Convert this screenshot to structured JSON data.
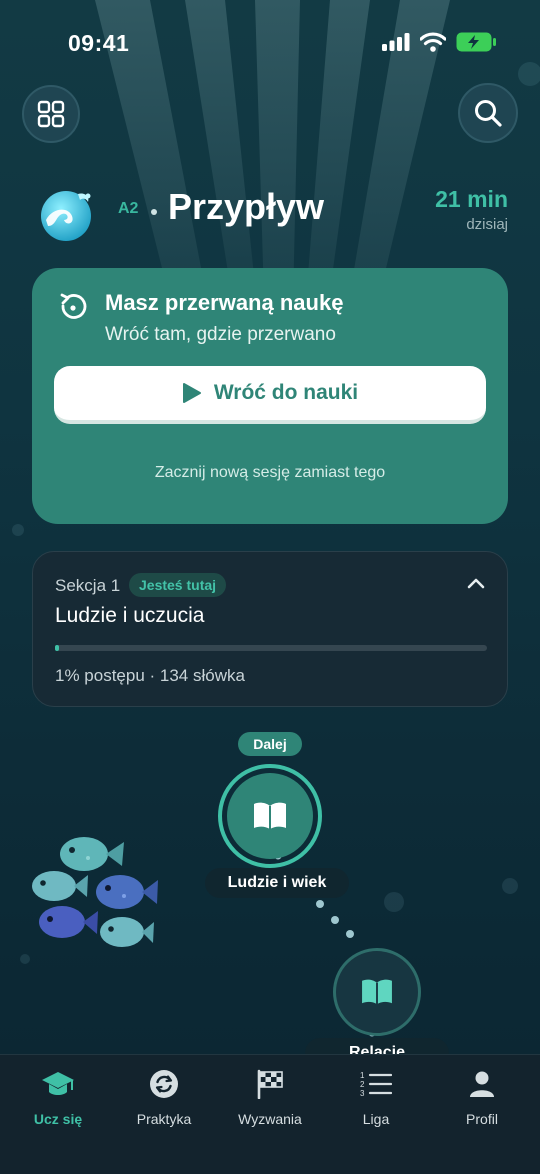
{
  "status_bar": {
    "time": "09:41"
  },
  "header": {
    "level": "A2",
    "course_title": "Przypływ",
    "minutes": "21 min",
    "minutes_caption": "dzisiaj"
  },
  "resume": {
    "title": "Masz przerwaną naukę",
    "subtitle": "Wróć tam, gdzie przerwano",
    "button_label": "Wróć do nauki",
    "secondary_link": "Zacznij nową sesję zamiast tego"
  },
  "section": {
    "number_label": "Sekcja 1",
    "badge": "Jesteś tutaj",
    "title": "Ludzie i uczucia",
    "progress_percent": 1,
    "stats": "1% postępu · 134 słówka"
  },
  "path": {
    "next_badge": "Dalej",
    "nodes": [
      {
        "label": "Ludzie i wiek",
        "icon": "book-icon",
        "state": "current"
      },
      {
        "label": "Relacje",
        "icon": "book-icon",
        "state": "locked"
      }
    ]
  },
  "bottom_nav": {
    "items": [
      {
        "label": "Ucz się",
        "icon": "graduation-cap-icon",
        "active": true
      },
      {
        "label": "Praktyka",
        "icon": "refresh-icon",
        "active": false
      },
      {
        "label": "Wyzwania",
        "icon": "checkered-flag-icon",
        "active": false
      },
      {
        "label": "Liga",
        "icon": "numbered-list-icon",
        "active": false
      },
      {
        "label": "Profil",
        "icon": "person-icon",
        "active": false
      }
    ]
  },
  "colors": {
    "accent": "#3fc0a6",
    "card_green": "#2f8577",
    "background": "#0f3440"
  }
}
